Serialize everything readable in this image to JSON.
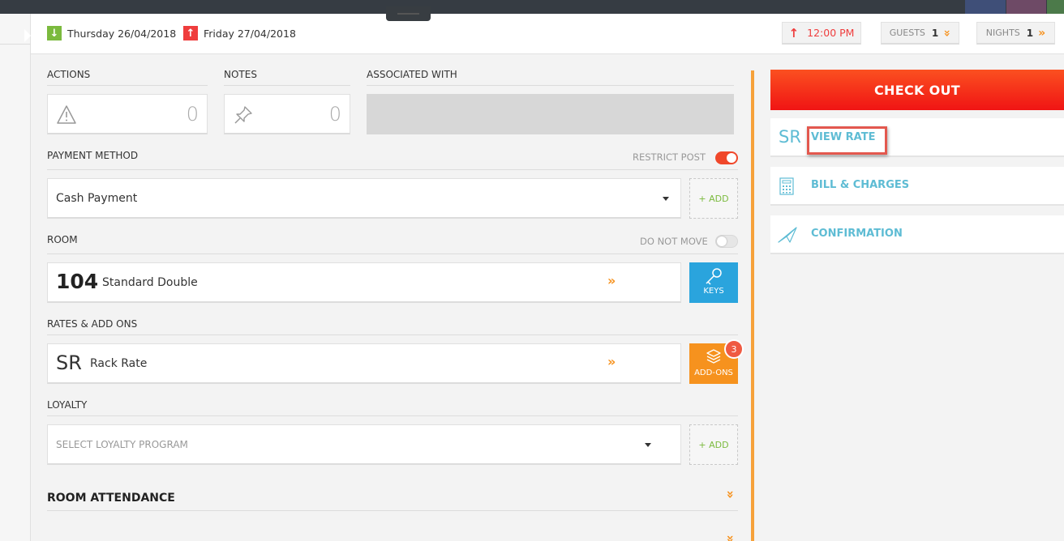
{
  "header": {
    "arrival": {
      "date": "Thursday 26/04/2018",
      "color": "#7bba3e"
    },
    "departure": {
      "date": "Friday 27/04/2018",
      "color": "#ef3d3d"
    },
    "time": "12:00 PM",
    "guests": {
      "label": "GUESTS",
      "value": "1"
    },
    "nights": {
      "label": "NIGHTS",
      "value": "1"
    }
  },
  "actions": {
    "label": "ACTIONS",
    "count": "0",
    "icon": "warning-icon"
  },
  "notes": {
    "label": "NOTES",
    "count": "0",
    "icon": "pin-icon"
  },
  "associated": {
    "label": "ASSOCIATED WITH"
  },
  "payment": {
    "label": "PAYMENT METHOD",
    "restrict_label": "RESTRICT POST",
    "restrict_on": true,
    "selected": "Cash Payment",
    "add_label": "+ ADD"
  },
  "room": {
    "label": "ROOM",
    "do_not_move_label": "DO NOT MOVE",
    "do_not_move_on": false,
    "number": "104",
    "type": "Standard Double",
    "keys_label": "KEYS"
  },
  "rates": {
    "label": "RATES & ADD ONS",
    "code": "SR",
    "name": "Rack Rate",
    "addons_label": "ADD-ONS",
    "addons_count": "3"
  },
  "loyalty": {
    "label": "LOYALTY",
    "placeholder": "SELECT LOYALTY PROGRAM",
    "add_label": "+ ADD"
  },
  "room_attendance": {
    "label": "ROOM ATTENDANCE"
  },
  "right_panel": {
    "checkout_label": "CHECK OUT",
    "rate_code": "SR",
    "view_rate_label": "VIEW RATE",
    "bill_label": "BILL & CHARGES",
    "confirmation_label": "CONFIRMATION"
  },
  "colors": {
    "accent_orange": "#f6921e",
    "accent_blue": "#2aa4dd",
    "link_blue": "#5ebcd4",
    "checkout_red": "#f01414",
    "highlight": "#e3584e"
  }
}
